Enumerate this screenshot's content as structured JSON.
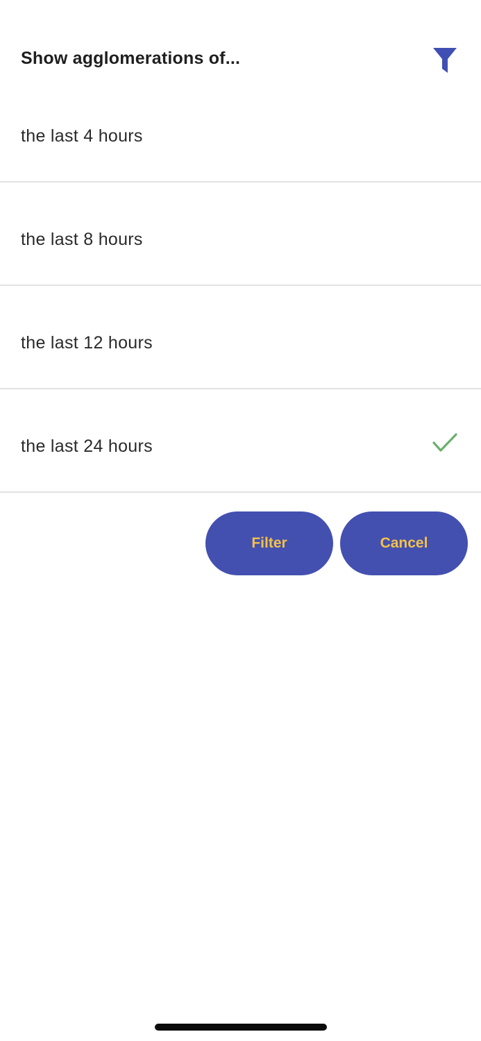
{
  "header": {
    "title": "Show agglomerations of...",
    "filter_icon": "filter-funnel-icon",
    "icon_color": "#3f4fb3"
  },
  "options": [
    {
      "label": "the last 4 hours",
      "selected": false
    },
    {
      "label": "the last 8 hours",
      "selected": false
    },
    {
      "label": "the last 12 hours",
      "selected": false
    },
    {
      "label": "the last 24 hours",
      "selected": true
    }
  ],
  "selected_icon": "checkmark-icon",
  "check_color": "#6ab06a",
  "actions": {
    "filter_label": "Filter",
    "cancel_label": "Cancel",
    "button_bg": "#4350b0",
    "button_text_color": "#f4c148"
  }
}
